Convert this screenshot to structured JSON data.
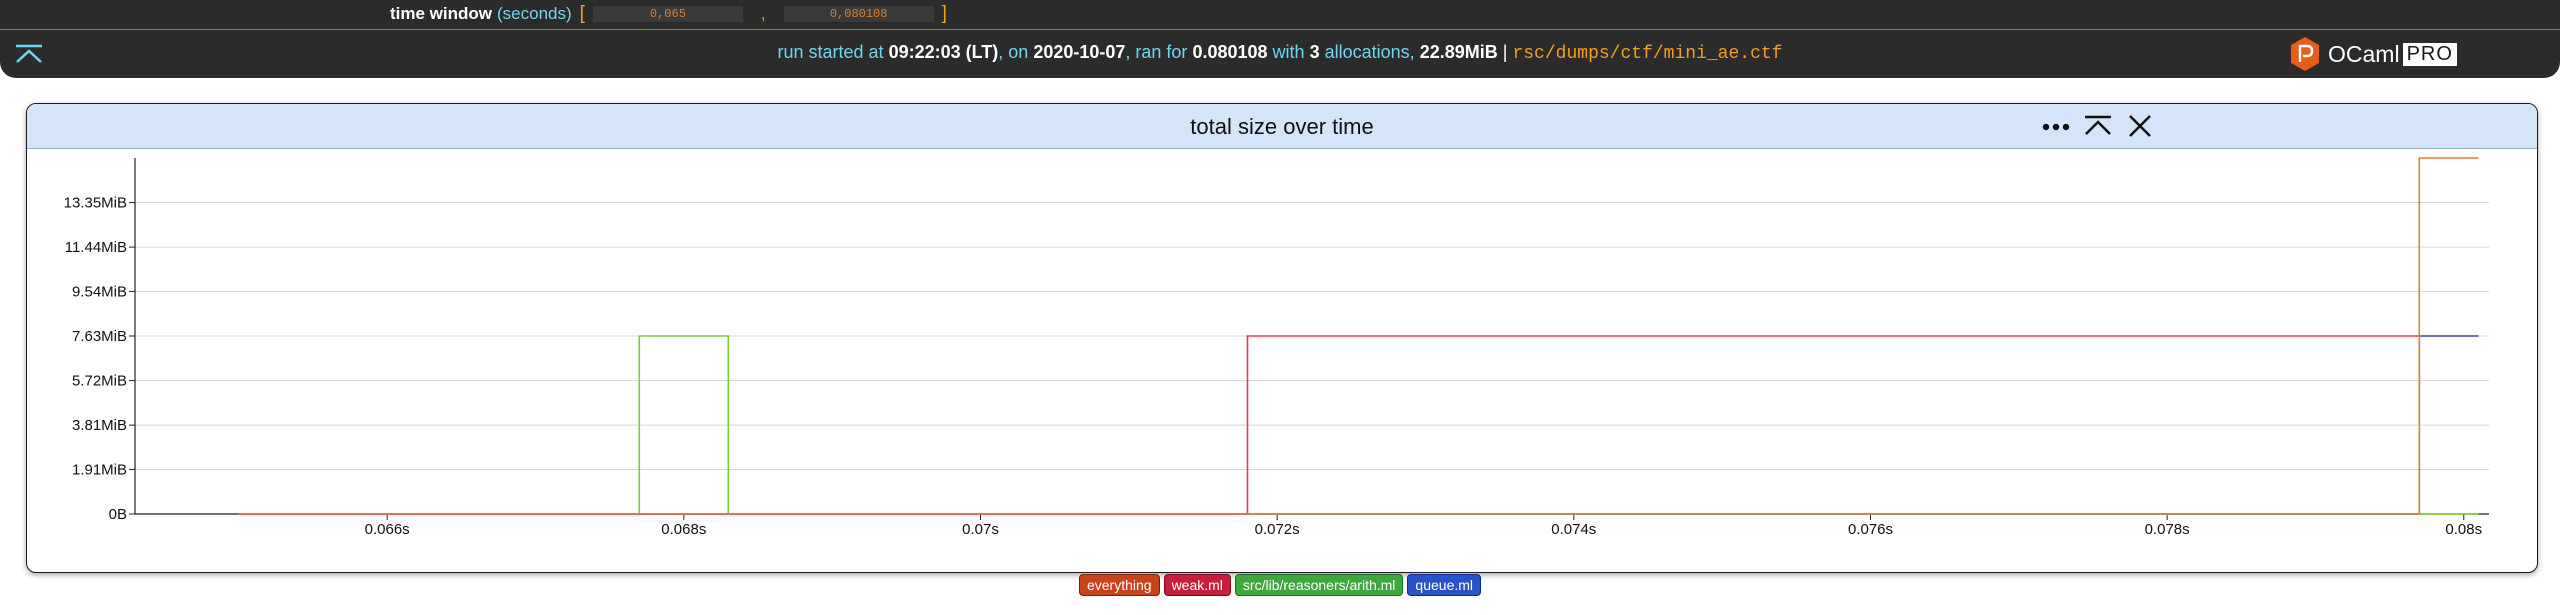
{
  "header": {
    "time_window": {
      "label": "time window",
      "unit": "(seconds)",
      "open_bracket": "[",
      "close_bracket": "]",
      "separator": ",",
      "start_value": "0,065",
      "end_value": "0,080108"
    },
    "run_info": {
      "run_started_at": "run started at",
      "time": "09:22:03 (LT)",
      "on": ", on",
      "date": "2020-10-07",
      "ran_for": ", ran for",
      "duration": "0.080108",
      "with": "with",
      "alloc_count": "3",
      "allocations": "allocations,",
      "size": "22.89MiB",
      "pipe": "|",
      "path": "rsc/dumps/ctf/mini_ae.ctf"
    },
    "logo": {
      "ocaml": "OCaml",
      "pro": "PRO"
    }
  },
  "panel": {
    "title": "total size over time"
  },
  "icons": {
    "collapse": "collapse-up-icon",
    "more": "more-horizontal-icon",
    "minimize": "collapse-up-icon",
    "close": "close-icon"
  },
  "legend": [
    {
      "label": "everything",
      "bg": "#c8431b",
      "border": "#7a2008"
    },
    {
      "label": "weak.ml",
      "bg": "#c81e3c",
      "border": "#7a0a1e"
    },
    {
      "label": "src/lib/reasoners/arith.ml",
      "bg": "#3ea83e",
      "border": "#1a6a1a"
    },
    {
      "label": "queue.ml",
      "bg": "#2a52c8",
      "border": "#0a2a8a"
    }
  ],
  "chart_data": {
    "type": "line",
    "interpolation": "step",
    "title": "total size over time",
    "xlabel": "",
    "ylabel": "",
    "xlim": [
      0.0643,
      0.08017
    ],
    "ylim": [
      0,
      15.26
    ],
    "x_ticks": [
      0.066,
      0.068,
      0.07,
      0.072,
      0.074,
      0.076,
      0.078,
      0.08
    ],
    "x_tick_labels": [
      "0.066s",
      "0.068s",
      "0.07s",
      "0.072s",
      "0.074s",
      "0.076s",
      "0.078s",
      "0.08s"
    ],
    "y_ticks": [
      0,
      1.91,
      3.81,
      5.72,
      7.63,
      9.54,
      11.44,
      13.35
    ],
    "y_tick_labels": [
      "0B",
      "1.91MiB",
      "3.81MiB",
      "5.72MiB",
      "7.63MiB",
      "9.54MiB",
      "11.44MiB",
      "13.35MiB"
    ],
    "grid": true,
    "legend_position": "bottom",
    "series": [
      {
        "name": "src/lib/reasoners/arith.ml",
        "color": "#7ccd2c",
        "x": [
          0.065,
          0.0677,
          0.0677,
          0.0683,
          0.0683,
          0.0801
        ],
        "y": [
          0,
          0,
          7.63,
          7.63,
          0,
          0
        ]
      },
      {
        "name": "weak.ml",
        "color": "#e8384f",
        "x": [
          0.065,
          0.0718,
          0.0718,
          0.0801
        ],
        "y": [
          0,
          0,
          7.63,
          7.63
        ]
      },
      {
        "name": "queue.ml",
        "color": "#3a6ad8",
        "x": [
          0.065,
          0.0797,
          0.0797,
          0.0801
        ],
        "y": [
          0,
          0,
          7.63,
          7.63
        ]
      },
      {
        "name": "everything",
        "color": "#f07a3a",
        "x": [
          0.065,
          0.0797,
          0.0797,
          0.0801
        ],
        "y": [
          0,
          0,
          15.26,
          15.26
        ]
      }
    ]
  }
}
